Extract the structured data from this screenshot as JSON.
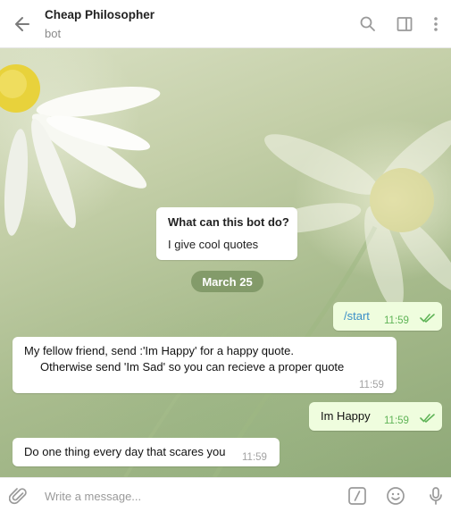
{
  "header": {
    "title": "Cheap Philosopher",
    "subtitle": "bot",
    "icons": [
      "back-arrow-icon",
      "search-icon",
      "sidebar-toggle-icon",
      "more-vertical-icon"
    ]
  },
  "chat": {
    "bot_info": {
      "question": "What can this bot do?",
      "answer": "I give cool quotes"
    },
    "date_separator": "March 25",
    "messages": [
      {
        "direction": "out",
        "text": "/start",
        "time": "11:59",
        "read": true
      },
      {
        "direction": "in",
        "line1": "My fellow friend, send :'Im Happy' for a happy quote.",
        "line2": "Otherwise send 'Im Sad' so you can recieve a proper quote",
        "time": "11:59"
      },
      {
        "direction": "out",
        "text": "Im Happy",
        "time": "11:59",
        "read": true
      },
      {
        "direction": "in",
        "text": "Do one thing every day that scares you",
        "time": "11:59"
      }
    ]
  },
  "footer": {
    "placeholder": "Write a message...",
    "icons": [
      "paperclip-icon",
      "bot-command-icon",
      "emoji-icon",
      "microphone-icon"
    ]
  },
  "colors": {
    "link": "#3a8fc7",
    "outgoing_bubble": "#effdde",
    "outgoing_time": "#5fb457",
    "date_pill": "#7c9461"
  }
}
